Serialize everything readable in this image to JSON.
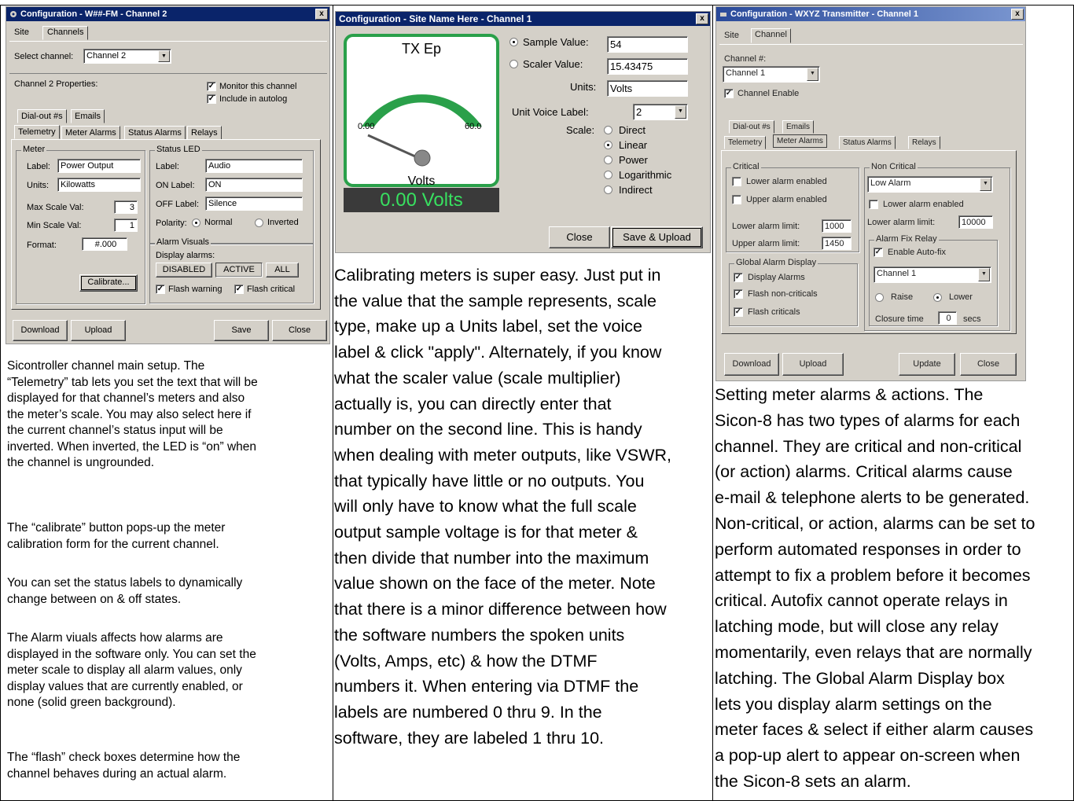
{
  "d1": {
    "title": "Configuration - W##-FM - Channel 2",
    "tab_site": "Site",
    "tab_channels": "Channels",
    "select_channel_label": "Select channel:",
    "select_channel_value": "Channel 2",
    "props_label": "Channel 2 Properties:",
    "monitor": "Monitor this channel",
    "autolog": "Include in autolog",
    "tab_dialout": "Dial-out #s",
    "tab_emails": "Emails",
    "tab_telemetry": "Telemetry",
    "tab_meter_alarms": "Meter Alarms",
    "tab_status_alarms": "Status Alarms",
    "tab_relays": "Relays",
    "meter_group": "Meter",
    "label_label": "Label:",
    "label_value": "Power Output",
    "units_label": "Units:",
    "units_value": "Kilowatts",
    "max_label": "Max Scale Val:",
    "max_value": "3",
    "min_label": "Min Scale Val:",
    "min_value": "1",
    "format_label": "Format:",
    "format_value": "#.000",
    "calibrate": "Calibrate...",
    "led_group": "Status LED",
    "led_label_label": "Label:",
    "led_label_value": "Audio",
    "on_label": "ON Label:",
    "on_value": "ON",
    "off_label": "OFF Label:",
    "off_value": "Silence",
    "polarity_label": "Polarity:",
    "polarity_normal": "Normal",
    "polarity_inverted": "Inverted",
    "alarm_visuals": "Alarm Visuals",
    "display_alarms": "Display alarms:",
    "btn_disabled": "DISABLED",
    "btn_active": "ACTIVE",
    "btn_all": "ALL",
    "flash_warning": "Flash warning",
    "flash_critical": "Flash critical",
    "download": "Download",
    "upload": "Upload",
    "save": "Save",
    "close": "Close"
  },
  "d2": {
    "title": "Configuration - Site Name Here - Channel 1",
    "meter_title": "TX Ep",
    "meter_min": "0.00",
    "meter_max": "60.0",
    "meter_units": "Volts",
    "meter_readout": "0.00 Volts",
    "sample_label": "Sample Value:",
    "sample_value": "54",
    "scaler_label": "Scaler Value:",
    "scaler_value": "15.43475",
    "units_label": "Units:",
    "units_value": "Volts",
    "voice_label": "Unit Voice Label:",
    "voice_value": "2",
    "scale_label": "Scale:",
    "scale_direct": "Direct",
    "scale_linear": "Linear",
    "scale_power": "Power",
    "scale_log": "Logarithmic",
    "scale_indirect": "Indirect",
    "close": "Close",
    "save_upload": "Save & Upload"
  },
  "d3": {
    "title": "Configuration - WXYZ Transmitter - Channel 1",
    "tab_site": "Site",
    "tab_channel": "Channel",
    "channel_no": "Channel #:",
    "channel_value": "Channel 1",
    "channel_enable": "Channel Enable",
    "tab_dialout": "Dial-out #s",
    "tab_emails": "Emails",
    "tab_telemetry": "Telemetry",
    "tab_meter_alarms": "Meter Alarms",
    "tab_status_alarms": "Status Alarms",
    "tab_relays": "Relays",
    "critical": "Critical",
    "lower_enabled": "Lower alarm enabled",
    "upper_enabled": "Upper alarm enabled",
    "lower_limit_label": "Lower alarm limit:",
    "lower_limit_value": "1000",
    "upper_limit_label": "Upper alarm limit:",
    "upper_limit_value": "1450",
    "noncritical": "Non Critical",
    "nc_select": "Low Alarm",
    "nc_lower_enabled": "Lower alarm enabled",
    "nc_lower_limit_label": "Lower alarm limit:",
    "nc_lower_limit_value": "10000",
    "fix_relay": "Alarm Fix Relay",
    "enable_autofix": "Enable Auto-fix",
    "fix_channel": "Channel 1",
    "raise": "Raise",
    "lower": "Lower",
    "closure_label": "Closure time",
    "closure_value": "0",
    "secs": "secs",
    "global": "Global Alarm Display",
    "display_alarms": "Display Alarms",
    "flash_noncrit": "Flash non-criticals",
    "flash_crit": "Flash criticals",
    "download": "Download",
    "upload": "Upload",
    "update": "Update",
    "close": "Close"
  },
  "text1": {
    "p1": [
      "Sicontroller channel main setup.  The",
      "“Telemetry” tab lets you set the text that will be",
      "displayed for that channel’s meters and also",
      "the meter’s scale.  You may also select here if",
      "the current channel’s status input will be",
      "inverted.  When inverted, the LED is “on” when",
      "the channel is ungrounded."
    ],
    "p2": [
      "The “calibrate” button pops-up the meter",
      "calibration form for the current channel."
    ],
    "p3": [
      "You can set the status labels to dynamically",
      "change between on & off states."
    ],
    "p4": [
      "The Alarm viuals affects how alarms are",
      "displayed in the software only.  You can set the",
      "meter scale to display all alarm values, only",
      "display values that are currently enabled, or",
      "none (solid green background)."
    ],
    "p5": [
      "The “flash” check boxes determine how the",
      "channel behaves during an actual alarm."
    ]
  },
  "text2": [
    "Calibrating meters is super easy. Just put in",
    "the value that the sample represents, scale",
    "type,  make up a Units label, set the voice",
    "label & click \"apply\".  Alternately, if you know",
    "what the scaler value (scale multiplier)",
    "actually is, you can directly enter that",
    "number on the second line.  This is handy",
    "when dealing with meter outputs, like VSWR,",
    "that typically have little or no outputs. You",
    "will only have to know what the full scale",
    "output sample voltage is for that meter &",
    "then divide that number into the maximum",
    "value shown on the face of the meter.  Note",
    "that there is a minor difference between how",
    "the software numbers the spoken units",
    "(Volts, Amps, etc)  & how the DTMF",
    "numbers it.  When entering via DTMF the",
    "labels are numbered 0 thru 9.  In the",
    "software, they are labeled 1 thru 10."
  ],
  "text3": [
    "Setting meter alarms & actions.  The",
    "Sicon-8 has two types of alarms for each",
    "channel.  They are critical and non-critical",
    "(or action) alarms.  Critical alarms cause",
    "e-mail & telephone alerts to be generated.",
    "Non-critical, or action, alarms can be set to",
    "perform automated responses in order to",
    "attempt to fix a problem before it becomes",
    "critical.  Autofix cannot operate relays in",
    "latching mode, but will close any relay",
    "momentarily, even relays that are normally",
    "latching.  The Global Alarm Display box",
    "lets you display alarm settings on the",
    "meter faces & select if either alarm causes",
    "a pop-up alert to appear on-screen when",
    "the Sicon-8 sets an alarm."
  ],
  "colors": {
    "meter_green": "#2aa04a",
    "readout_green": "#38e060",
    "readout_bg": "#3a3a3a",
    "title_blue": "#0a246a"
  }
}
